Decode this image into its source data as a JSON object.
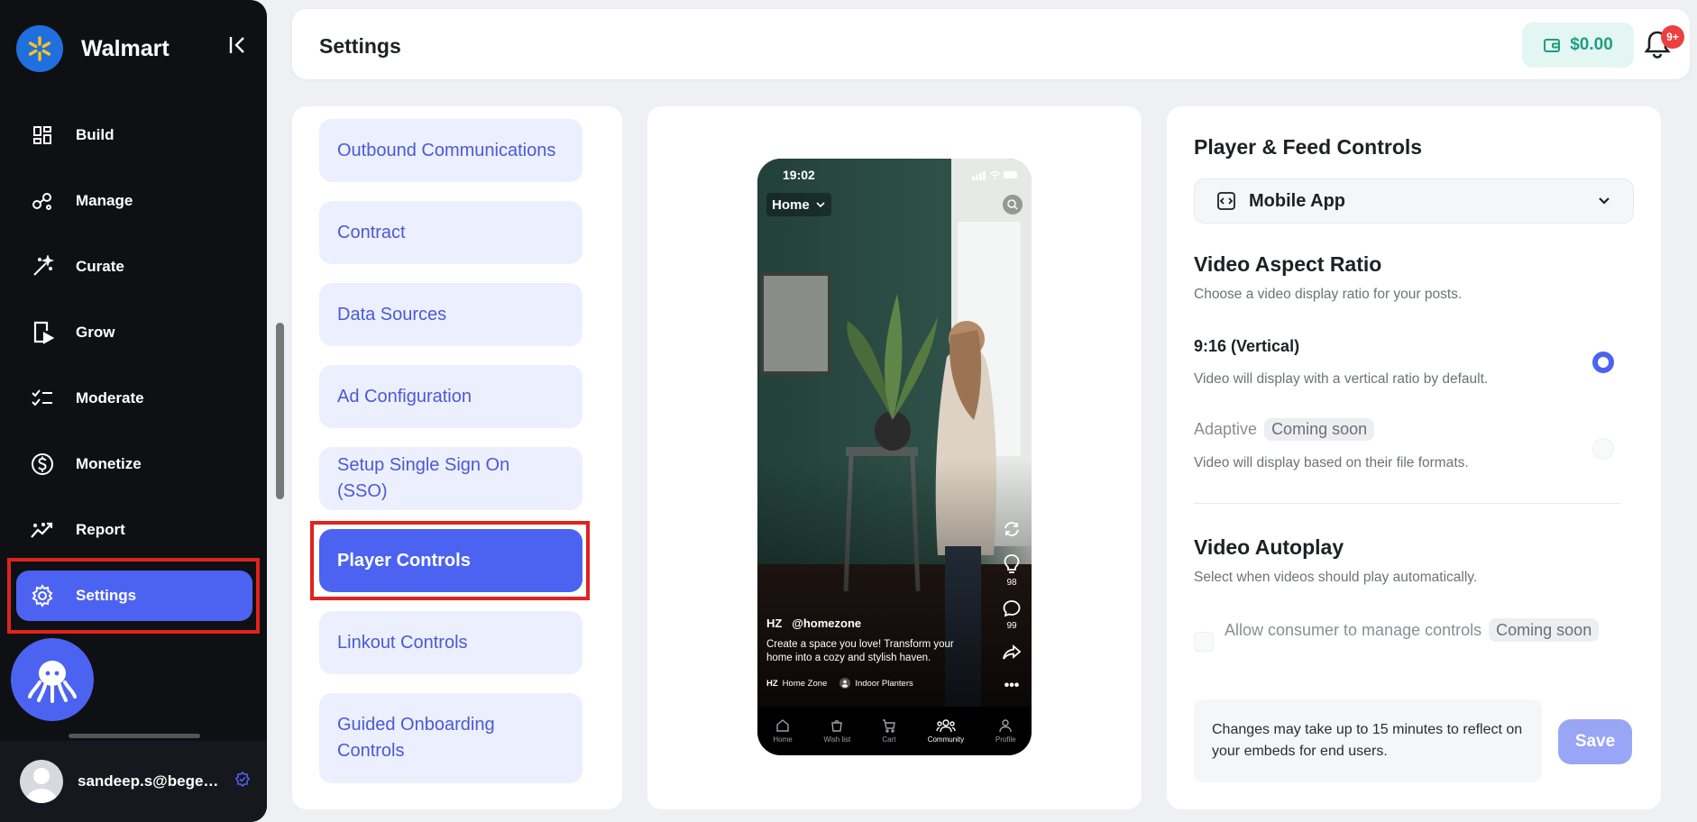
{
  "sidebar": {
    "brand": "Walmart",
    "items": [
      {
        "label": "Build",
        "icon": "grid-icon"
      },
      {
        "label": "Manage",
        "icon": "nodes-icon"
      },
      {
        "label": "Curate",
        "icon": "magic-wand-icon"
      },
      {
        "label": "Grow",
        "icon": "phone-play-icon"
      },
      {
        "label": "Moderate",
        "icon": "checklist-icon"
      },
      {
        "label": "Monetize",
        "icon": "dollar-icon"
      },
      {
        "label": "Report",
        "icon": "chart-line-icon"
      },
      {
        "label": "Settings",
        "icon": "gear-icon",
        "active": true
      }
    ],
    "user_email": "sandeep.s@begenuin.com"
  },
  "header": {
    "title": "Settings",
    "wallet": "$0.00",
    "notification_badge": "9+"
  },
  "menu": {
    "items": [
      {
        "label": "Outbound Communications"
      },
      {
        "label": "Contract"
      },
      {
        "label": "Data Sources"
      },
      {
        "label": "Ad Configuration"
      },
      {
        "label": "Setup Single Sign On (SSO)"
      },
      {
        "label": "Player Controls",
        "active": true
      },
      {
        "label": "Linkout Controls"
      },
      {
        "label": "Guided Onboarding Controls"
      }
    ]
  },
  "preview": {
    "time": "19:02",
    "feed_label": "Home",
    "like_count": "98",
    "comment_count": "99",
    "handle_initials": "HZ",
    "handle": "@homezone",
    "caption": "Create a space you love! Transform your home into a cozy and stylish haven.",
    "tag1_initials": "HZ",
    "tag1": "Home Zone",
    "tag2": "Indoor Planters",
    "nav": [
      "Home",
      "Wish list",
      "Cart",
      "Community",
      "Profile"
    ]
  },
  "controls": {
    "title": "Player & Feed Controls",
    "platform": "Mobile App",
    "aspect": {
      "title": "Video Aspect Ratio",
      "desc": "Choose a video display ratio for your posts.",
      "opt1_title": "9:16 (Vertical)",
      "opt1_desc": "Video will display with a vertical ratio by default.",
      "opt2_title": "Adaptive",
      "opt2_badge": "Coming soon",
      "opt2_desc": "Video will display based on their file formats."
    },
    "autoplay": {
      "title": "Video Autoplay",
      "desc": "Select when videos should play automatically.",
      "checkbox_label": "Allow consumer to manage controls",
      "checkbox_badge": "Coming soon"
    },
    "note": "Changes may take up to 15 minutes to reflect on your embeds for end users.",
    "save_label": "Save"
  },
  "colors": {
    "accent": "#4c63f2",
    "highlight": "#e0231d",
    "sidebar_bg": "#0f1014",
    "wallet_text": "#1f9e82"
  }
}
